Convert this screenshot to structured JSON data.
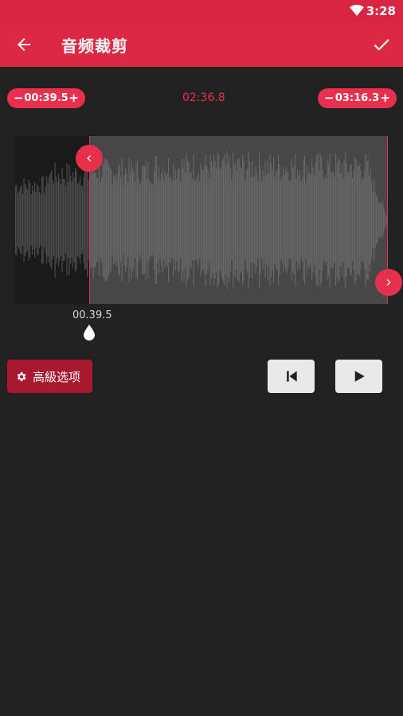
{
  "status": {
    "time": "3:28"
  },
  "header": {
    "title": "音频裁剪"
  },
  "trim": {
    "start": "00:39.5",
    "end": "03:16.3",
    "duration": "02:36.8",
    "minus": "−",
    "plus": "+",
    "cursor_time": "00.39.5"
  },
  "controls": {
    "advanced_label": "高級选项"
  },
  "colors": {
    "accent": "#e8304d",
    "appbar": "#dc2843",
    "background": "#212121",
    "wave_selected": "#666666",
    "wave_unselected": "#4a4a4a"
  },
  "icons": {
    "back": "arrow-left-icon",
    "confirm": "check-icon",
    "wifi": "wifi-icon",
    "settings": "gear-icon",
    "restart": "skip-previous-icon",
    "play": "play-icon",
    "handle_left": "chevron-left-icon",
    "handle_right": "chevron-right-icon"
  }
}
